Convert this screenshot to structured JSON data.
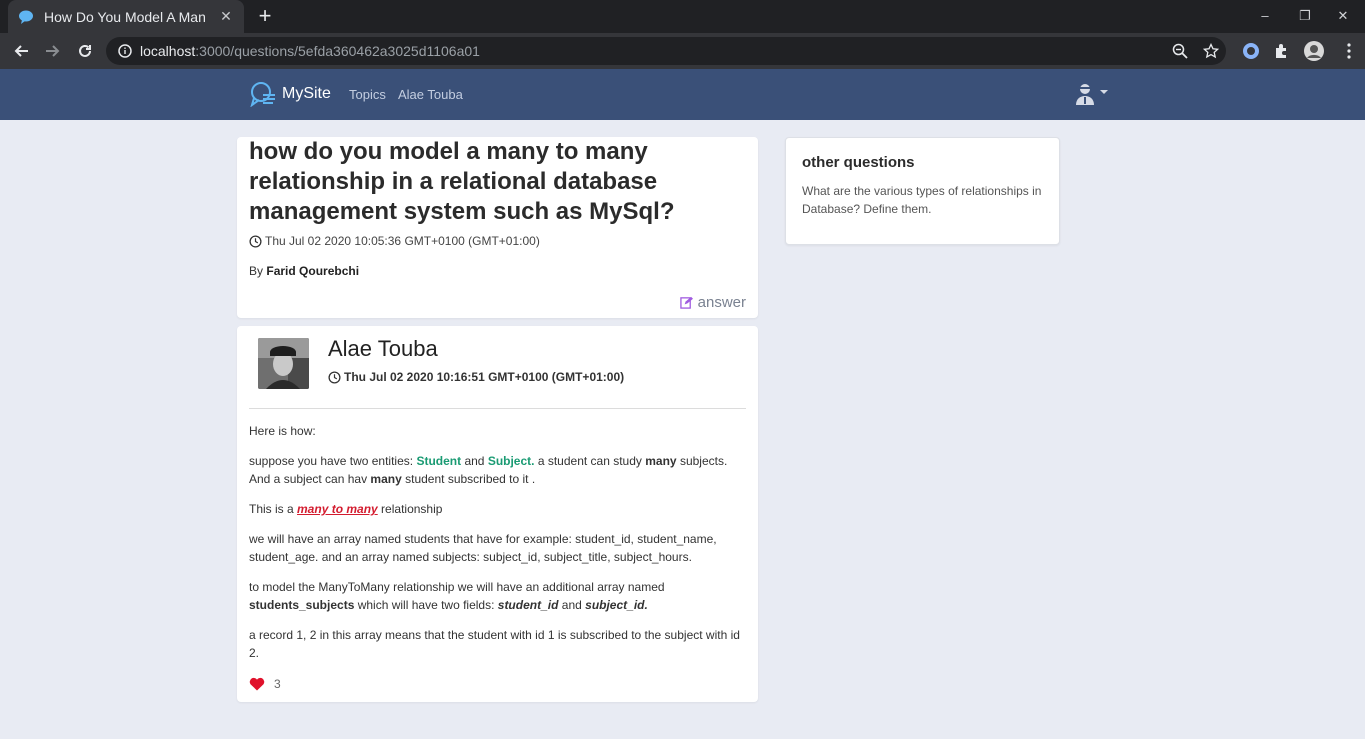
{
  "browser": {
    "tab_title": "How Do You Model A Man",
    "url_host": "localhost",
    "url_path": ":3000/questions/5efda360462a3025d1106a01"
  },
  "site": {
    "brand": "MySite",
    "nav": [
      "Topics",
      "Alae Touba"
    ]
  },
  "question": {
    "title": "how do you model a many to many relationship in a relational database management system such as MySql?",
    "date": "Thu Jul 02 2020 10:05:36 GMT+0100 (GMT+01:00)",
    "by_label": "By",
    "author": "Farid Qourebchi",
    "answer_label": "answer"
  },
  "answer": {
    "author": "Alae Touba",
    "date": "Thu Jul 02 2020 10:16:51 GMT+0100 (GMT+01:00)",
    "p1": "Here is how:",
    "p2a": "suppose you have two entities: ",
    "p2_student": "Student",
    "p2b": " and ",
    "p2_subject": "Subject.",
    "p2c": " a student can study ",
    "p2_many1": "many",
    "p2d": " subjects. And a subject can hav ",
    "p2_many2": "many",
    "p2e": " student subscribed to it  .",
    "p3a": "This is a ",
    "p3_link": "many to many",
    "p3b": " relationship",
    "p4": "we will have an array named students that have for example: student_id, student_name, student_age. and an array named subjects: subject_id, subject_title, subject_hours.",
    "p5a": "to model the ManyToMany relationship we will have an additional array named ",
    "p5_table": "students_subjects",
    "p5b": " which will have two fields: ",
    "p5_f1": "student_id",
    "p5c": " and ",
    "p5_f2": "subject_id.",
    "p6": "a record 1, 2 in this array means that the student with id 1 is subscribed to the subject with id 2.",
    "likes": "3"
  },
  "sidebar": {
    "title": "other questions",
    "items": [
      "What are the various types of relationships in Database? Define them."
    ]
  },
  "colors": {
    "header": "#3a5078",
    "page_bg": "#e8ebf3",
    "accent_green": "#1a9b73",
    "accent_red": "#d31b2e",
    "heart": "#e0112b"
  }
}
